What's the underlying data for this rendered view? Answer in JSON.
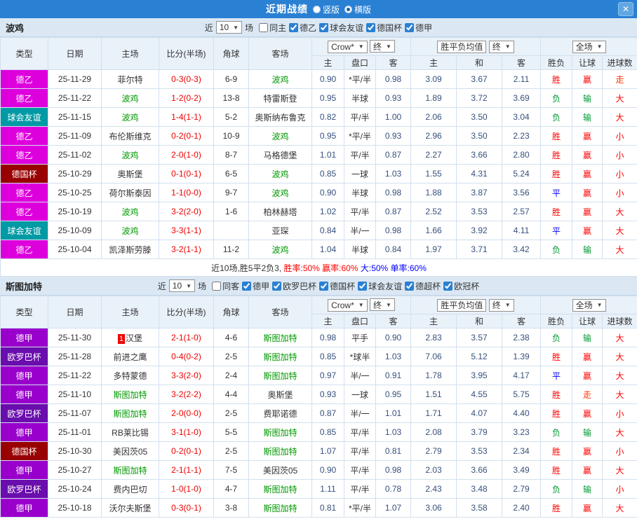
{
  "titlebar": {
    "title": "近期战绩",
    "radios": [
      {
        "label": "竖版",
        "selected": false
      },
      {
        "label": "横版",
        "selected": true
      }
    ],
    "close": "✕"
  },
  "filter_bar": {
    "prefix": "近",
    "match_count": "10",
    "suffix": "场"
  },
  "table_header": {
    "left_cols": [
      "类型",
      "日期",
      "主场",
      "比分(半场)",
      "角球",
      "客场"
    ],
    "bookmaker": "Crow*",
    "final": "终",
    "avg_label": "胜平负均值",
    "scope": "全场",
    "sub_cols": [
      "主",
      "盘口",
      "客",
      "主",
      "和",
      "客",
      "胜负",
      "让球",
      "进球数"
    ]
  },
  "league_colors": {
    "德乙": "#dd00dd",
    "球会友谊": "#009aa5",
    "德国杯": "#990000",
    "德甲": "#9900cc",
    "欧罗巴杯": "#6a0dad"
  },
  "result_colors": {
    "胜": "#ff0000",
    "平": "#0000ff",
    "负": "#009933",
    "赢": "#ff0000",
    "走": "#ff3300",
    "输": "#009933",
    "大": "#ff0000",
    "小": "#ff0000"
  },
  "teams": [
    {
      "name": "波鸡",
      "filters": [
        {
          "label": "同主",
          "checked": false
        },
        {
          "label": "德乙",
          "checked": true
        },
        {
          "label": "球会友谊",
          "checked": true
        },
        {
          "label": "德国杯",
          "checked": true
        },
        {
          "label": "德甲",
          "checked": true
        }
      ],
      "rows": [
        {
          "league": "德乙",
          "date": "25-11-29",
          "home": "菲尔特",
          "score": "0-3(0-3)",
          "corners": "6-9",
          "away": "波鸡",
          "odds": [
            "0.90",
            "*平/半",
            "0.98"
          ],
          "avg": [
            "3.09",
            "3.67",
            "2.11"
          ],
          "wdl": "胜",
          "handicap": "赢",
          "goals": "走"
        },
        {
          "league": "德乙",
          "date": "25-11-22",
          "home": "波鸡",
          "score": "1-2(0-2)",
          "corners": "13-8",
          "away": "特雷斯登",
          "odds": [
            "0.95",
            "半球",
            "0.93"
          ],
          "avg": [
            "1.89",
            "3.72",
            "3.69"
          ],
          "wdl": "负",
          "handicap": "输",
          "goals": "大"
        },
        {
          "league": "球会友谊",
          "date": "25-11-15",
          "home": "波鸡",
          "score": "1-4(1-1)",
          "corners": "5-2",
          "away": "奥斯纳布鲁克",
          "odds": [
            "0.82",
            "平/半",
            "1.00"
          ],
          "avg": [
            "2.06",
            "3.50",
            "3.04"
          ],
          "wdl": "负",
          "handicap": "输",
          "goals": "大"
        },
        {
          "league": "德乙",
          "date": "25-11-09",
          "home": "布伦斯维克",
          "score": "0-2(0-1)",
          "corners": "10-9",
          "away": "波鸡",
          "odds": [
            "0.95",
            "*平/半",
            "0.93"
          ],
          "avg": [
            "2.96",
            "3.50",
            "2.23"
          ],
          "wdl": "胜",
          "handicap": "赢",
          "goals": "小"
        },
        {
          "league": "德乙",
          "date": "25-11-02",
          "home": "波鸡",
          "score": "2-0(1-0)",
          "corners": "8-7",
          "away": "马格德堡",
          "odds": [
            "1.01",
            "平/半",
            "0.87"
          ],
          "avg": [
            "2.27",
            "3.66",
            "2.80"
          ],
          "wdl": "胜",
          "handicap": "赢",
          "goals": "小"
        },
        {
          "league": "德国杯",
          "date": "25-10-29",
          "home": "奥斯堡",
          "score": "0-1(0-1)",
          "corners": "6-5",
          "away": "波鸡",
          "odds": [
            "0.85",
            "一球",
            "1.03"
          ],
          "avg": [
            "1.55",
            "4.31",
            "5.24"
          ],
          "wdl": "胜",
          "handicap": "赢",
          "goals": "小"
        },
        {
          "league": "德乙",
          "date": "25-10-25",
          "home": "荷尔斯泰因",
          "score": "1-1(0-0)",
          "corners": "9-7",
          "away": "波鸡",
          "odds": [
            "0.90",
            "半球",
            "0.98"
          ],
          "avg": [
            "1.88",
            "3.87",
            "3.56"
          ],
          "wdl": "平",
          "handicap": "赢",
          "goals": "小"
        },
        {
          "league": "德乙",
          "date": "25-10-19",
          "home": "波鸡",
          "score": "3-2(2-0)",
          "corners": "1-6",
          "away": "柏林赫塔",
          "odds": [
            "1.02",
            "平/半",
            "0.87"
          ],
          "avg": [
            "2.52",
            "3.53",
            "2.57"
          ],
          "wdl": "胜",
          "handicap": "赢",
          "goals": "大"
        },
        {
          "league": "球会友谊",
          "date": "25-10-09",
          "home": "波鸡",
          "score": "3-3(1-1)",
          "corners": "",
          "away": "亚琛",
          "odds": [
            "0.84",
            "半/一",
            "0.98"
          ],
          "avg": [
            "1.66",
            "3.92",
            "4.11"
          ],
          "wdl": "平",
          "handicap": "赢",
          "goals": "大"
        },
        {
          "league": "德乙",
          "date": "25-10-04",
          "home": "凯泽斯劳滕",
          "score": "3-2(1-1)",
          "corners": "11-2",
          "away": "波鸡",
          "odds": [
            "1.04",
            "半球",
            "0.84"
          ],
          "avg": [
            "1.97",
            "3.71",
            "3.42"
          ],
          "wdl": "负",
          "handicap": "输",
          "goals": "大"
        }
      ],
      "summary": [
        {
          "text": "近10场,胜5平2负3, ",
          "color": "#333333"
        },
        {
          "text": "胜率:50% ",
          "color": "#ff0000"
        },
        {
          "text": "赢率:60% ",
          "color": "#ff0000"
        },
        {
          "text": "大:50% ",
          "color": "#0000ff"
        },
        {
          "text": "单率:60%",
          "color": "#0000ff"
        }
      ]
    },
    {
      "name": "斯图加特",
      "filters": [
        {
          "label": "同客",
          "checked": false
        },
        {
          "label": "德甲",
          "checked": true
        },
        {
          "label": "欧罗巴杯",
          "checked": true
        },
        {
          "label": "德国杯",
          "checked": true
        },
        {
          "label": "球会友谊",
          "checked": true
        },
        {
          "label": "德超杯",
          "checked": true
        },
        {
          "label": "欧冠杯",
          "checked": true
        }
      ],
      "rows": [
        {
          "league": "德甲",
          "date": "25-11-30",
          "home": "汉堡",
          "home_badge": "1",
          "score": "2-1(1-0)",
          "corners": "4-6",
          "away": "斯图加特",
          "odds": [
            "0.98",
            "平手",
            "0.90"
          ],
          "avg": [
            "2.83",
            "3.57",
            "2.38"
          ],
          "wdl": "负",
          "handicap": "输",
          "goals": "大"
        },
        {
          "league": "欧罗巴杯",
          "date": "25-11-28",
          "home": "前进之鹰",
          "score": "0-4(0-2)",
          "corners": "2-5",
          "away": "斯图加特",
          "odds": [
            "0.85",
            "*球半",
            "1.03"
          ],
          "avg": [
            "7.06",
            "5.12",
            "1.39"
          ],
          "wdl": "胜",
          "handicap": "赢",
          "goals": "大"
        },
        {
          "league": "德甲",
          "date": "25-11-22",
          "home": "多特蒙德",
          "score": "3-3(2-0)",
          "corners": "2-4",
          "away": "斯图加特",
          "odds": [
            "0.97",
            "半/一",
            "0.91"
          ],
          "avg": [
            "1.78",
            "3.95",
            "4.17"
          ],
          "wdl": "平",
          "handicap": "赢",
          "goals": "大"
        },
        {
          "league": "德甲",
          "date": "25-11-10",
          "home": "斯图加特",
          "score": "3-2(2-2)",
          "corners": "4-4",
          "away": "奥斯堡",
          "odds": [
            "0.93",
            "一球",
            "0.95"
          ],
          "avg": [
            "1.51",
            "4.55",
            "5.75"
          ],
          "wdl": "胜",
          "handicap": "走",
          "goals": "大"
        },
        {
          "league": "欧罗巴杯",
          "date": "25-11-07",
          "home": "斯图加特",
          "score": "2-0(0-0)",
          "corners": "2-5",
          "away": "费耶诺德",
          "odds": [
            "0.87",
            "半/一",
            "1.01"
          ],
          "avg": [
            "1.71",
            "4.07",
            "4.40"
          ],
          "wdl": "胜",
          "handicap": "赢",
          "goals": "小"
        },
        {
          "league": "德甲",
          "date": "25-11-01",
          "home": "RB莱比锡",
          "score": "3-1(1-0)",
          "corners": "5-5",
          "away": "斯图加特",
          "odds": [
            "0.85",
            "平/半",
            "1.03"
          ],
          "avg": [
            "2.08",
            "3.79",
            "3.23"
          ],
          "wdl": "负",
          "handicap": "输",
          "goals": "大"
        },
        {
          "league": "德国杯",
          "date": "25-10-30",
          "home": "美因茨05",
          "score": "0-2(0-1)",
          "corners": "2-5",
          "away": "斯图加特",
          "odds": [
            "1.07",
            "平/半",
            "0.81"
          ],
          "avg": [
            "2.79",
            "3.53",
            "2.34"
          ],
          "wdl": "胜",
          "handicap": "赢",
          "goals": "小"
        },
        {
          "league": "德甲",
          "date": "25-10-27",
          "home": "斯图加特",
          "score": "2-1(1-1)",
          "corners": "7-5",
          "away": "美因茨05",
          "odds": [
            "0.90",
            "平/半",
            "0.98"
          ],
          "avg": [
            "2.03",
            "3.66",
            "3.49"
          ],
          "wdl": "胜",
          "handicap": "赢",
          "goals": "大"
        },
        {
          "league": "欧罗巴杯",
          "date": "25-10-24",
          "home": "费内巴切",
          "score": "1-0(1-0)",
          "corners": "4-7",
          "away": "斯图加特",
          "odds": [
            "1.11",
            "平/半",
            "0.78"
          ],
          "avg": [
            "2.43",
            "3.48",
            "2.79"
          ],
          "wdl": "负",
          "handicap": "输",
          "goals": "小"
        },
        {
          "league": "德甲",
          "date": "25-10-18",
          "home": "沃尔夫斯堡",
          "score": "0-3(0-1)",
          "corners": "3-8",
          "away": "斯图加特",
          "odds": [
            "0.81",
            "*平/半",
            "1.07"
          ],
          "avg": [
            "3.06",
            "3.58",
            "2.40"
          ],
          "wdl": "胜",
          "handicap": "赢",
          "goals": "大"
        }
      ]
    }
  ]
}
